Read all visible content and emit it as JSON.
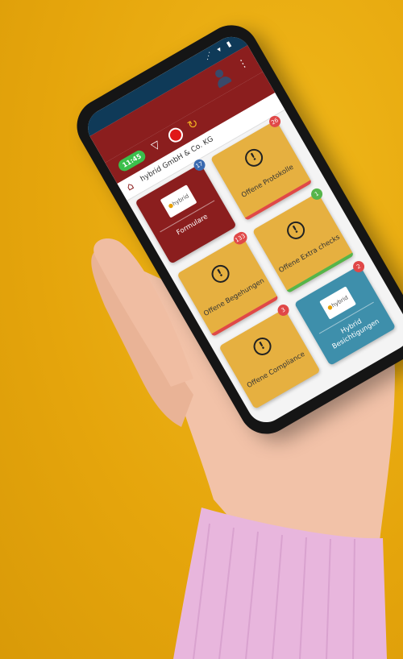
{
  "status_bar": {
    "icons": "⋰ ▾ ▮"
  },
  "appbar": {
    "menu_glyph": "⋮"
  },
  "toolbar": {
    "time": "11:45"
  },
  "company_name": "hybrid GmbH & Co. KG",
  "tiles": [
    {
      "label": "Formulare",
      "badge": "17",
      "color": "red",
      "badge_color": "blue",
      "icon": "logo-icon"
    },
    {
      "label": "Offene Protokolle",
      "badge": "26",
      "color": "orange",
      "badge_color": "red",
      "icon": "alert-icon"
    },
    {
      "label": "Offene Begehungen",
      "badge": "133",
      "color": "orange",
      "badge_color": "red",
      "icon": "alert-icon"
    },
    {
      "label": "Offene Extra checks",
      "badge": "1",
      "color": "orange",
      "badge_color": "green",
      "icon": "alert-icon"
    },
    {
      "label": "Offene Compliance",
      "badge": "3",
      "color": "orange",
      "badge_color": "red",
      "icon": "alert-icon"
    },
    {
      "label": "Hybrid Besichtigungen",
      "badge": "2",
      "color": "teal",
      "badge_color": "red",
      "icon": "logo-icon"
    }
  ],
  "logo_text": "hybrid",
  "alert_glyph": "!",
  "colors": {
    "background": "#e8ab10",
    "appbar": "#8b1e1e",
    "status_bar": "#0f3a58",
    "tile_orange": "#e6b040",
    "tile_teal": "#3e8fab"
  }
}
